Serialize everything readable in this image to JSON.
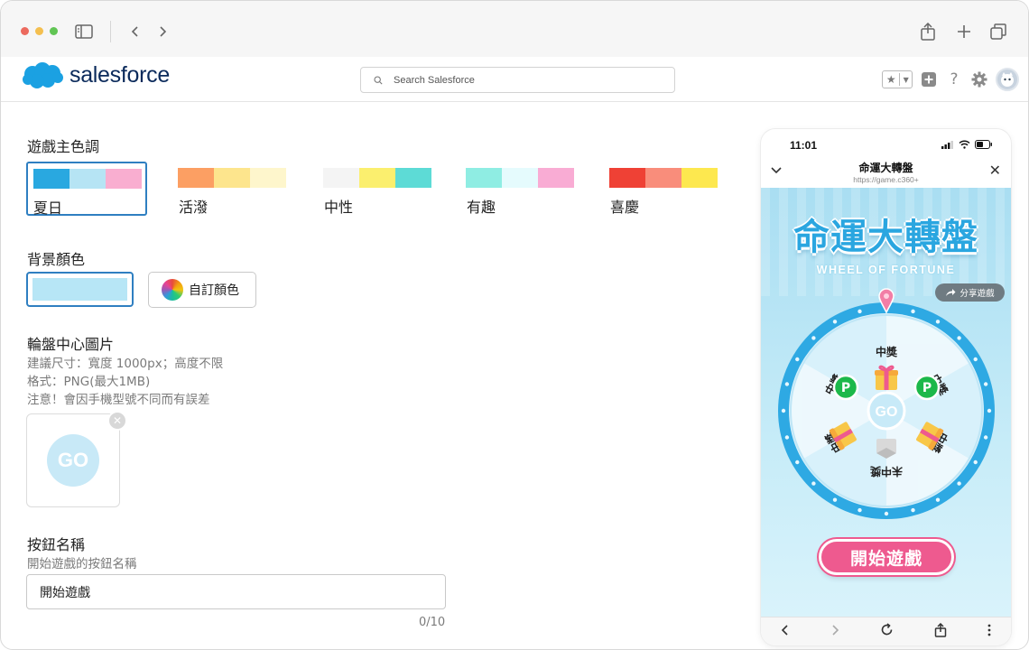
{
  "browser": {
    "dot_colors": [
      "#ec6a5e",
      "#f4bf4f",
      "#61c554"
    ]
  },
  "header": {
    "logo_text": "salesforce",
    "search_placeholder": "Search Salesforce"
  },
  "form": {
    "theme_title": "遊戲主色調",
    "themes": [
      {
        "name": "夏日",
        "colors": [
          "#29a8e0",
          "#b6e4f4",
          "#f9aed0"
        ],
        "selected": true
      },
      {
        "name": "活潑",
        "colors": [
          "#fc9f63",
          "#fde58d",
          "#fef6cc"
        ],
        "selected": false
      },
      {
        "name": "中性",
        "colors": [
          "#f4f4f4",
          "#fbef6e",
          "#5ddbd6"
        ],
        "selected": false
      },
      {
        "name": "有趣",
        "colors": [
          "#8fede3",
          "#e5fbfd",
          "#f9acd4"
        ],
        "selected": false
      },
      {
        "name": "喜慶",
        "colors": [
          "#ef4135",
          "#f98d7b",
          "#fde84f"
        ],
        "selected": false
      }
    ],
    "bg_title": "背景顏色",
    "bg_color": "#b7e6f6",
    "custom_color_label": "自訂顏色",
    "center_img_title": "輪盤中心圖片",
    "center_img_hints": [
      "建議尺寸：寬度 1000px；高度不限",
      "格式：PNG(最大1MB)",
      "注意！會因手機型號不同而有誤差"
    ],
    "center_img_go": "GO",
    "btn_name_title": "按鈕名稱",
    "btn_name_hint": "開始遊戲的按鈕名稱",
    "btn_name_value": "開始遊戲",
    "btn_name_counter": "0/10"
  },
  "phone": {
    "time": "11:01",
    "title": "命運大轉盤",
    "url": "https://game.c360+",
    "game_title": "命運大轉盤",
    "game_subtitle": "WHEEL OF FORTUNE",
    "share_label": "分享遊戲",
    "wheel_center": "GO",
    "prize_won": "中獎",
    "prize_lost": "未中獎",
    "start_label": "開始遊戲"
  }
}
